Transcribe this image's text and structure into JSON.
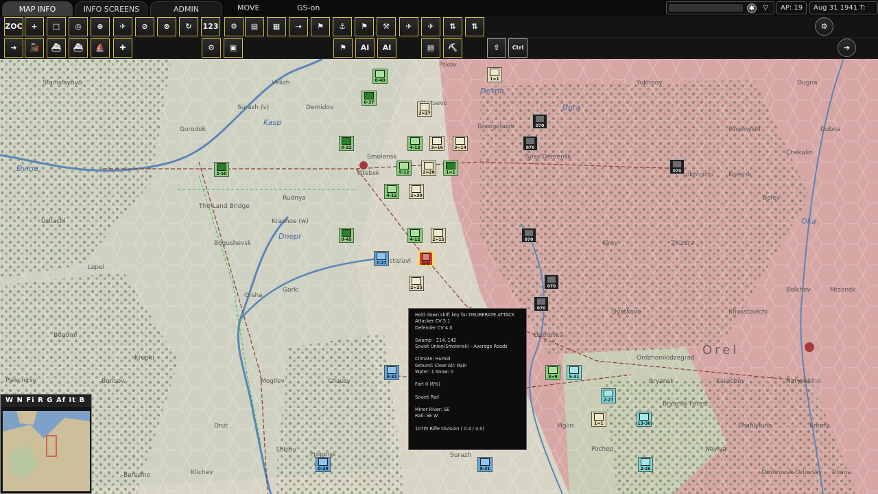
{
  "tabs": {
    "map_info": "MAP INFO",
    "info_screens": "INFO SCREENS",
    "admin": "ADMIN"
  },
  "menu": {
    "move": "MOVE",
    "gs": "GS-on"
  },
  "status": {
    "ap": "AP: 19",
    "date": "Aug 31 1941",
    "turn": "T: 11"
  },
  "toolbar": {
    "row1": [
      "ZOC",
      "+",
      "□",
      "◎",
      "⊕",
      "✈",
      "⊘",
      "⊗",
      "↻",
      "123",
      "⚙",
      "▤",
      "▦",
      "⇢",
      "⚑",
      "⚓",
      "⚑",
      "⚒"
    ],
    "row1b": [
      "✈",
      "✈",
      "⇅",
      "⇅"
    ],
    "row2": [
      "➜",
      "🚂",
      "⛴",
      "⛴",
      "⛵",
      "✚"
    ],
    "row2b": [
      "⚙",
      "▣",
      "⚑",
      "AI",
      "AI",
      "▤",
      "⛏"
    ],
    "row2c": [
      "⇧",
      "Ctrl"
    ],
    "right_top": "⚙",
    "right_bottom": "➔"
  },
  "map": {
    "labels": [
      {
        "name": "Smolensk",
        "type": "town"
      },
      {
        "name": "Yartsevo",
        "type": "town"
      },
      {
        "name": "Dorogobuzh",
        "type": "town"
      },
      {
        "name": "Vitebsk",
        "type": "town"
      },
      {
        "name": "Gorodok",
        "type": "town"
      },
      {
        "name": "Demidov",
        "type": "town"
      },
      {
        "name": "Surazh (v)",
        "type": "town"
      },
      {
        "name": "Velizh",
        "type": "town"
      },
      {
        "name": "Stanislavovo",
        "type": "town"
      },
      {
        "name": "Pskov",
        "type": "town"
      },
      {
        "name": "Dvina",
        "type": "river"
      },
      {
        "name": "Kasp",
        "type": "river"
      },
      {
        "name": "The Land Bridge",
        "type": "region"
      },
      {
        "name": "Rudnya",
        "type": "town"
      },
      {
        "name": "Krasnoe (w)",
        "type": "town"
      },
      {
        "name": "Dnepr",
        "type": "river"
      },
      {
        "name": "Bogushevsk",
        "type": "town"
      },
      {
        "name": "Lepel",
        "type": "town"
      },
      {
        "name": "Ushachi",
        "type": "town"
      },
      {
        "name": "Orsha",
        "type": "town"
      },
      {
        "name": "Gorki",
        "type": "town"
      },
      {
        "name": "Mstislavl",
        "type": "town"
      },
      {
        "name": "Chausy",
        "type": "town"
      },
      {
        "name": "Mogilev",
        "type": "town"
      },
      {
        "name": "Shklov",
        "type": "town"
      },
      {
        "name": "Berezino",
        "type": "town"
      },
      {
        "name": "Klichev",
        "type": "town"
      },
      {
        "name": "Krupki",
        "type": "town"
      },
      {
        "name": "Plescnitsy",
        "type": "town"
      },
      {
        "name": "Borisov",
        "type": "town"
      },
      {
        "name": "Begoml",
        "type": "town"
      },
      {
        "name": "Drut",
        "type": "town"
      },
      {
        "name": "Propoisk",
        "type": "town"
      },
      {
        "name": "Surazh",
        "type": "town"
      },
      {
        "name": "Spas Demensk",
        "type": "town"
      },
      {
        "name": "Sukhinichi",
        "type": "town"
      },
      {
        "name": "Kozelsk",
        "type": "town"
      },
      {
        "name": "Belev",
        "type": "town"
      },
      {
        "name": "Kirov",
        "type": "town"
      },
      {
        "name": "Zhizdra",
        "type": "town"
      },
      {
        "name": "Bolkhov",
        "type": "town"
      },
      {
        "name": "Mtsensk",
        "type": "town"
      },
      {
        "name": "Dyatkovo",
        "type": "town"
      },
      {
        "name": "Khvastovichi",
        "type": "town"
      },
      {
        "name": "Dubrovka",
        "type": "town"
      },
      {
        "name": "Ordzhonikidzegrad",
        "type": "town"
      },
      {
        "name": "Bryansk",
        "type": "town"
      },
      {
        "name": "Karachev",
        "type": "town"
      },
      {
        "name": "Naryshkino",
        "type": "town"
      },
      {
        "name": "Orel",
        "type": "region"
      },
      {
        "name": "Bryansk Forest",
        "type": "region"
      },
      {
        "name": "Mglin",
        "type": "town"
      },
      {
        "name": "Pochep",
        "type": "town"
      },
      {
        "name": "Navlya",
        "type": "town"
      },
      {
        "name": "Shablykino",
        "type": "town"
      },
      {
        "name": "Kromy",
        "type": "town"
      },
      {
        "name": "Trosna",
        "type": "town"
      },
      {
        "name": "Dmitrovsk-Orlovsky",
        "type": "town"
      },
      {
        "name": "Yukhnov",
        "type": "town"
      },
      {
        "name": "Dugna",
        "type": "town"
      },
      {
        "name": "Peremyshl",
        "type": "town"
      },
      {
        "name": "Dubna",
        "type": "town"
      },
      {
        "name": "Chekalin",
        "type": "town"
      },
      {
        "name": "Ugra",
        "type": "river"
      },
      {
        "name": "Desna",
        "type": "river"
      },
      {
        "name": "Oka",
        "type": "river"
      }
    ],
    "units": [
      {
        "label": "0-40",
        "kind": "u-sov"
      },
      {
        "label": "0-37",
        "kind": "u-hq"
      },
      {
        "label": "1=1",
        "kind": "u-sovarm"
      },
      {
        "label": "2=27",
        "kind": "u-sovarm"
      },
      {
        "label": "4-12",
        "kind": "u-sov"
      },
      {
        "label": "3=16",
        "kind": "u-sovarm"
      },
      {
        "label": "3=14",
        "kind": "u-sovarm"
      },
      {
        "label": "0-22",
        "kind": "u-hq"
      },
      {
        "label": "2-50",
        "kind": "u-hq"
      },
      {
        "label": "5-12",
        "kind": "u-sov"
      },
      {
        "label": "2=28",
        "kind": "u-sovarm"
      },
      {
        "label": "1=1",
        "kind": "u-hq"
      },
      {
        "label": "4-12",
        "kind": "u-sov"
      },
      {
        "label": "2=30",
        "kind": "u-sovarm"
      },
      {
        "label": "0-45",
        "kind": "u-hq"
      },
      {
        "label": "4-12",
        "kind": "u-sov"
      },
      {
        "label": "2=15",
        "kind": "u-sovarm"
      },
      {
        "label": "7-27",
        "kind": "u-blu"
      },
      {
        "label": "6-0",
        "kind": "u-red"
      },
      {
        "label": "2=25",
        "kind": "u-sovarm"
      },
      {
        "label": "070",
        "kind": "u-ger"
      },
      {
        "label": "070",
        "kind": "u-ger"
      },
      {
        "label": "070",
        "kind": "u-ger"
      },
      {
        "label": "070",
        "kind": "u-ger"
      },
      {
        "label": "070",
        "kind": "u-ger"
      },
      {
        "label": "070",
        "kind": "u-ger"
      },
      {
        "label": "3=9",
        "kind": "u-sov"
      },
      {
        "label": "5-31",
        "kind": "u-cyan"
      },
      {
        "label": "2-27",
        "kind": "u-cyan"
      },
      {
        "label": "13-30",
        "kind": "u-cyan"
      },
      {
        "label": "1=1",
        "kind": "u-sovarm"
      },
      {
        "label": "0-32",
        "kind": "u-blu"
      },
      {
        "label": "0-29",
        "kind": "u-blu"
      },
      {
        "label": "2-26",
        "kind": "u-cyan"
      },
      {
        "label": "5-31",
        "kind": "u-blu"
      }
    ]
  },
  "tooltip": {
    "line1": "Hold down shift key for DELIBERATE ATTACK",
    "line2": "Attacker CV 5.1",
    "line3": "Defender CV 4.0",
    "line4": "Swamp - 214, 142",
    "line5": "Soviet Union(Smolensk) - Average Roads",
    "line6": "Climate: Humid",
    "line7": "Ground: Clear  Air: Rain",
    "line8": "Water: 1  Snow: 0",
    "line9": "Fort  0 (6%)",
    "line10": "Soviet Rail",
    "line11": "Minor River:  SE",
    "line12": "Rail:  SE  W",
    "line13": "107th Rifle Division   ( 0.4 / 4.0)"
  },
  "minimap": {
    "tabs": "W N Fi R G Af It B"
  },
  "colors": {
    "toolbar_border": "#d4c04a",
    "soviet": "#7bcf6c",
    "axis": "#1f1f1f",
    "enemy_zone": "#d9a8a8"
  }
}
